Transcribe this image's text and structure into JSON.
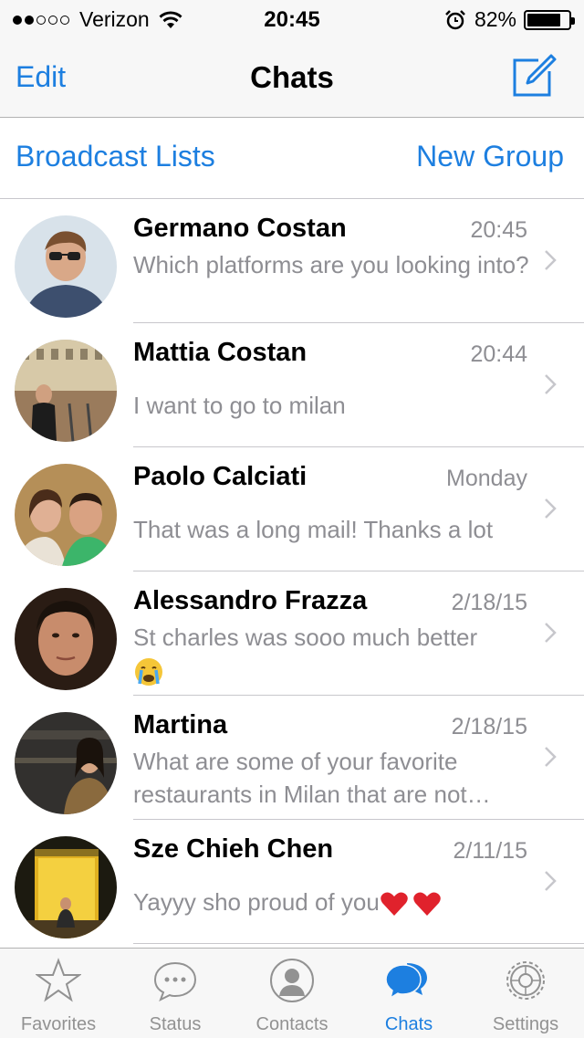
{
  "status_bar": {
    "carrier": "Verizon",
    "time": "20:45",
    "battery": "82%",
    "battery_level": 0.82,
    "signal_bars": 2,
    "signal_total": 5
  },
  "nav": {
    "edit_label": "Edit",
    "title": "Chats"
  },
  "subbar": {
    "broadcast_label": "Broadcast Lists",
    "new_group_label": "New Group"
  },
  "chats": [
    {
      "name": "Germano Costan",
      "time": "20:45",
      "message": "Which platforms are you looking into?"
    },
    {
      "name": "Mattia Costan",
      "time": "20:44",
      "message": "I want to go to milan"
    },
    {
      "name": "Paolo Calciati",
      "time": "Monday",
      "message": "That was a long mail! Thanks a lot"
    },
    {
      "name": "Alessandro Frazza",
      "time": "2/18/15",
      "message": "St charles was sooo much better"
    },
    {
      "name": "Martina",
      "time": "2/18/15",
      "message": "What are some of your favorite restaurants in Milan that are not expensive?"
    },
    {
      "name": "Sze Chieh Chen",
      "time": "2/11/15",
      "message": "Yayyy sho proud of you"
    }
  ],
  "tabs": [
    {
      "label": "Favorites",
      "icon": "star-icon"
    },
    {
      "label": "Status",
      "icon": "speech-bubble-icon"
    },
    {
      "label": "Contacts",
      "icon": "person-icon"
    },
    {
      "label": "Chats",
      "icon": "chats-icon"
    },
    {
      "label": "Settings",
      "icon": "gear-icon"
    }
  ],
  "colors": {
    "accent": "#1d7fe0",
    "secondary_text": "#8e8e93",
    "bar_background": "#f7f7f7"
  }
}
